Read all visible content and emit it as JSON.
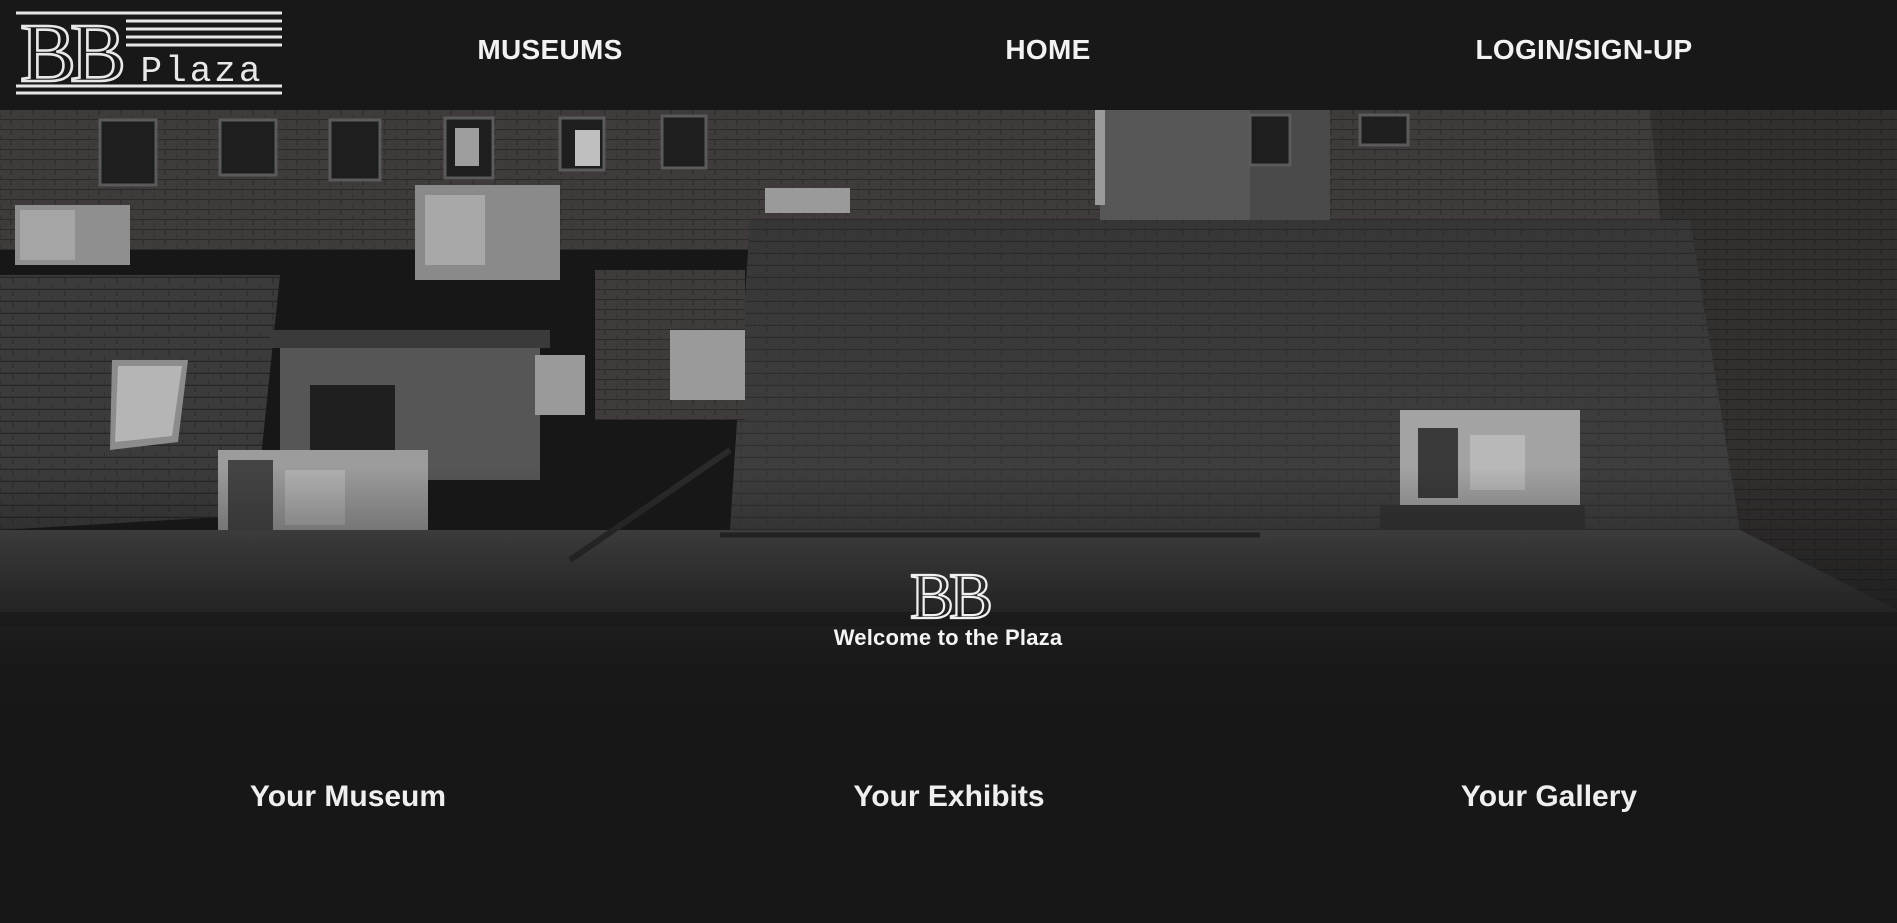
{
  "brand": {
    "logo_mark": "BB",
    "logo_word": "Plaza"
  },
  "nav": {
    "museums": "MUSEUMS",
    "home": "HOME",
    "login": "LOGIN/SIGN-UP"
  },
  "hero": {
    "emblem": "BB",
    "caption": "Welcome to the Plaza",
    "image_icon": "rooftop-photo"
  },
  "sections": {
    "museum": "Your Museum",
    "exhibits": "Your Exhibits",
    "gallery": "Your Gallery"
  },
  "colors": {
    "background": "#171717",
    "text": "#efefef"
  }
}
